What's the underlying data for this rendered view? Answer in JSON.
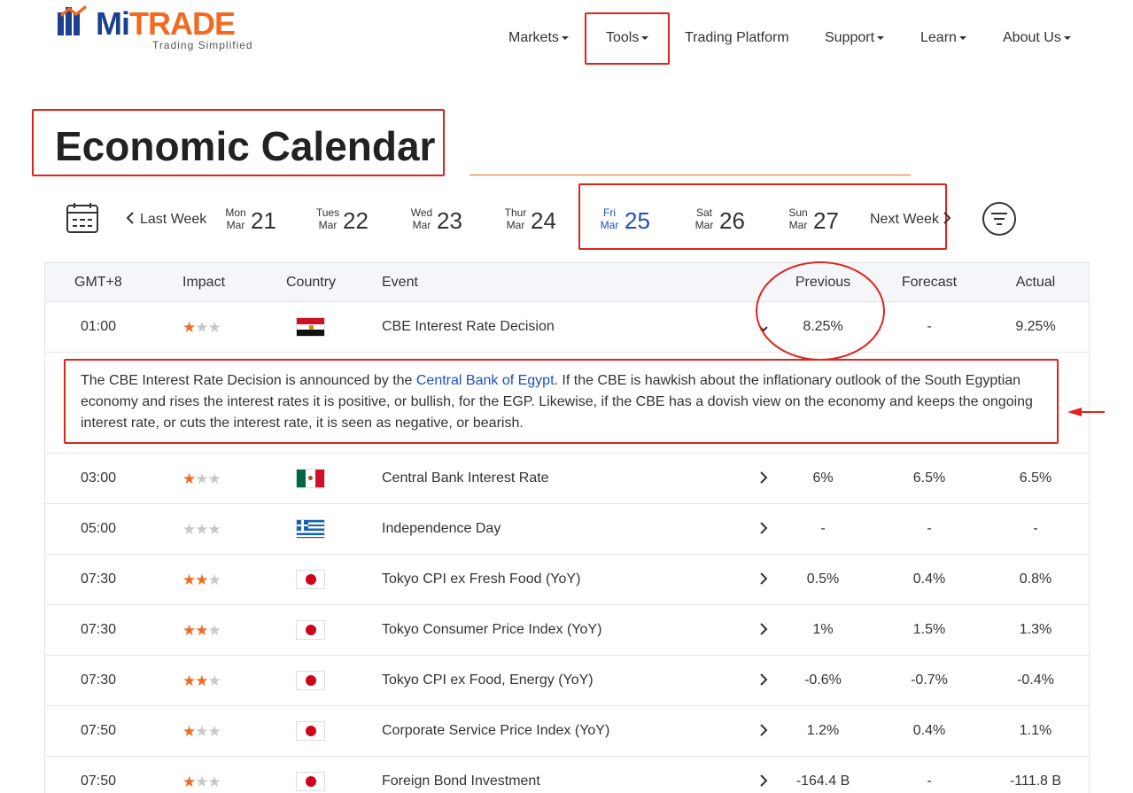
{
  "brand": {
    "name_part1": "Mi",
    "name_part2": "TRADE",
    "tagline": "Trading Simplified"
  },
  "nav": [
    {
      "label": "Markets",
      "dropdown": true
    },
    {
      "label": "Tools",
      "dropdown": true
    },
    {
      "label": "Trading Platform",
      "dropdown": false
    },
    {
      "label": "Support",
      "dropdown": true
    },
    {
      "label": "Learn",
      "dropdown": true
    },
    {
      "label": "About Us",
      "dropdown": true
    }
  ],
  "page": {
    "title": "Economic Calendar"
  },
  "datebar": {
    "prev_label": "Last Week",
    "next_label": "Next Week",
    "days": [
      {
        "name": "Mon",
        "month": "Mar",
        "date": "21",
        "active": false
      },
      {
        "name": "Tues",
        "month": "Mar",
        "date": "22",
        "active": false
      },
      {
        "name": "Wed",
        "month": "Mar",
        "date": "23",
        "active": false
      },
      {
        "name": "Thur",
        "month": "Mar",
        "date": "24",
        "active": false
      },
      {
        "name": "Fri",
        "month": "Mar",
        "date": "25",
        "active": true
      },
      {
        "name": "Sat",
        "month": "Mar",
        "date": "26",
        "active": false
      },
      {
        "name": "Sun",
        "month": "Mar",
        "date": "27",
        "active": false
      }
    ]
  },
  "table": {
    "headers": {
      "time": "GMT+8",
      "impact": "Impact",
      "country": "Country",
      "event": "Event",
      "previous": "Previous",
      "forecast": "Forecast",
      "actual": "Actual"
    },
    "rows": [
      {
        "time": "01:00",
        "impact": 1,
        "flag": "egypt-flag",
        "event": "CBE Interest Rate Decision",
        "previous": "8.25%",
        "forecast": "-",
        "actual": "9.25%",
        "expanded": true
      },
      {
        "time": "03:00",
        "impact": 1,
        "flag": "mexico-flag",
        "event": "Central Bank Interest Rate",
        "previous": "6%",
        "forecast": "6.5%",
        "actual": "6.5%"
      },
      {
        "time": "05:00",
        "impact": 0,
        "flag": "greece-flag",
        "event": "Independence Day",
        "previous": "-",
        "forecast": "-",
        "actual": "-"
      },
      {
        "time": "07:30",
        "impact": 2,
        "flag": "japan-flag",
        "event": "Tokyo CPI ex Fresh Food (YoY)",
        "previous": "0.5%",
        "forecast": "0.4%",
        "actual": "0.8%"
      },
      {
        "time": "07:30",
        "impact": 2,
        "flag": "japan-flag",
        "event": "Tokyo Consumer Price Index (YoY)",
        "previous": "1%",
        "forecast": "1.5%",
        "actual": "1.3%"
      },
      {
        "time": "07:30",
        "impact": 2,
        "flag": "japan-flag",
        "event": "Tokyo CPI ex Food, Energy (YoY)",
        "previous": "-0.6%",
        "forecast": "-0.7%",
        "actual": "-0.4%"
      },
      {
        "time": "07:50",
        "impact": 1,
        "flag": "japan-flag",
        "event": "Corporate Service Price Index (YoY)",
        "previous": "1.2%",
        "forecast": "0.4%",
        "actual": "1.1%"
      },
      {
        "time": "07:50",
        "impact": 1,
        "flag": "japan-flag",
        "event": "Foreign Bond Investment",
        "previous": "-164.4 B",
        "forecast": "-",
        "actual": "-111.8 B"
      }
    ],
    "description": {
      "before_link": "The CBE Interest Rate Decision is announced by the ",
      "link": "Central Bank of Egypt",
      "after_link": ". If the CBE is hawkish about the inflationary outlook of the South Egyptian economy and rises the interest rates it is positive, or bullish, for the EGP. Likewise, if the CBE has a dovish view on the economy and keeps the ongoing interest rate, or cuts the interest rate, it is seen as negative, or bearish."
    }
  },
  "colors": {
    "brand_blue": "#1d3f8f",
    "brand_orange": "#f26a21",
    "active_blue": "#1d4fbf",
    "annotation_red": "#e0231c"
  }
}
